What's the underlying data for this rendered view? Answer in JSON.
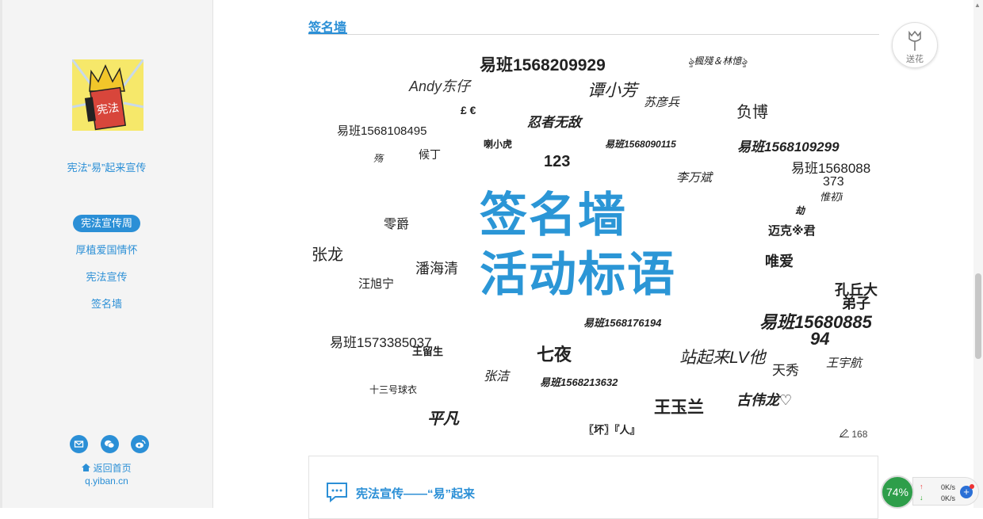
{
  "sidebar": {
    "site_title": "宪法“易”起来宣传",
    "avatar_text": "宪法",
    "nav": [
      {
        "label": "宪法宣传周",
        "active": true
      },
      {
        "label": "厚植爱国情怀",
        "active": false
      },
      {
        "label": "宪法宣传",
        "active": false
      },
      {
        "label": "签名墙",
        "active": false
      }
    ],
    "home_label": "返回首页",
    "home_url": "q.yiban.cn"
  },
  "main": {
    "section_title": "签名墙",
    "headline_line1": "签名墙",
    "headline_line2": "活动标语",
    "signature_count": "168",
    "signatures": [
      "易班1568209929",
      "ৡ楓殘＆林憶ৡ",
      "Andy东仔",
      "谭小芳",
      "苏彦兵",
      "£ €",
      "负博",
      "忍者无敌",
      "易班1568108495",
      "喇小虎",
      "易班1568090115",
      "易班1568109299",
      "殇",
      "候丁",
      "123",
      "易班1568088",
      "373",
      "李万斌",
      "惟初i",
      "劫",
      "零爵",
      "迈克※君",
      "张龙",
      "潘海清",
      "唯爱",
      "汪旭宁",
      "孔丘大",
      "弟子",
      "易班1568176194",
      "易班15680885",
      "94",
      "易班1573385037",
      "王留生",
      "七夜",
      "站起来LV他",
      "天秀",
      "王宇航",
      "张洁",
      "易班1568213632",
      "十三号球衣",
      "古伟龙♡",
      "平凡",
      "王玉兰",
      "〖坏〗『人』"
    ],
    "panel_title": "宪法宣传——“易”起来"
  },
  "flower_button": {
    "label": "送花"
  },
  "net_widget": {
    "percent": "74%",
    "up": "0K/s",
    "down": "0K/s"
  }
}
